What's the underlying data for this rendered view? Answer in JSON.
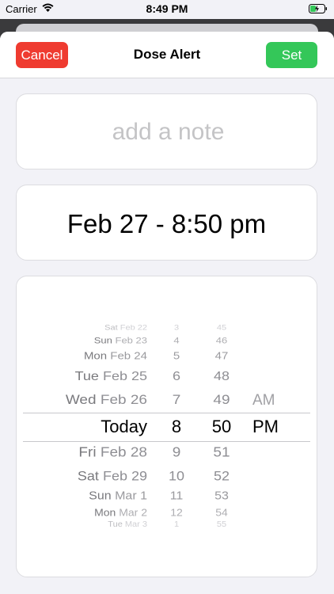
{
  "status": {
    "carrier": "Carrier",
    "time": "8:49 PM"
  },
  "nav": {
    "cancel_label": "Cancel",
    "title": "Dose Alert",
    "set_label": "Set"
  },
  "note": {
    "placeholder": "add a note",
    "value": ""
  },
  "selected_datetime": "Feb 27 - 8:50 pm",
  "picker": {
    "days": [
      {
        "weekday": "Sat",
        "date": "Feb 22"
      },
      {
        "weekday": "Sun",
        "date": "Feb 23"
      },
      {
        "weekday": "Mon",
        "date": "Feb 24"
      },
      {
        "weekday": "Tue",
        "date": "Feb 25"
      },
      {
        "weekday": "Wed",
        "date": "Feb 26"
      },
      {
        "weekday": "",
        "date": "Today"
      },
      {
        "weekday": "Fri",
        "date": "Feb 28"
      },
      {
        "weekday": "Sat",
        "date": "Feb 29"
      },
      {
        "weekday": "Sun",
        "date": "Mar 1"
      },
      {
        "weekday": "Mon",
        "date": "Mar 2"
      },
      {
        "weekday": "Tue",
        "date": "Mar 3"
      }
    ],
    "hours": [
      "3",
      "4",
      "5",
      "6",
      "7",
      "8",
      "9",
      "10",
      "11",
      "12",
      "1"
    ],
    "minutes": [
      "45",
      "46",
      "47",
      "48",
      "49",
      "50",
      "51",
      "52",
      "53",
      "54",
      "55"
    ],
    "ampm": [
      "AM",
      "PM"
    ],
    "selected_index": 5
  },
  "colors": {
    "cancel": "#ef3b30",
    "set": "#34c759"
  }
}
